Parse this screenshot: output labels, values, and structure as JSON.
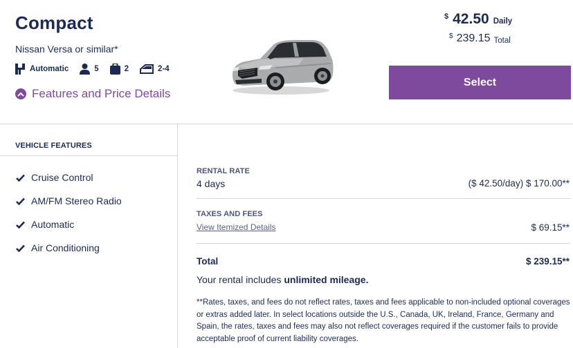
{
  "vehicle": {
    "class": "Compact",
    "model": "Nissan Versa or similar*",
    "transmission": "Automatic",
    "passengers": "5",
    "bags": "2",
    "doors": "2-4"
  },
  "features_toggle_label": "Features and Price Details",
  "pricing": {
    "currency_symbol": "$",
    "daily_amount": "42.50",
    "daily_label": "Daily",
    "total_amount": "239.15",
    "total_label": "Total"
  },
  "select_label": "Select",
  "vehicle_features": {
    "title": "VEHICLE FEATURES",
    "items": [
      "Cruise Control",
      "AM/FM Stereo Radio",
      "Automatic",
      "Air Conditioning"
    ]
  },
  "price_details": {
    "rental_rate": {
      "label": "RENTAL RATE",
      "duration": "4 days",
      "amount": "($ 42.50/day) $ 170.00**"
    },
    "taxes_fees": {
      "label": "TAXES AND FEES",
      "link": "View Itemized Details",
      "amount": "$ 69.15**"
    },
    "total": {
      "label": "Total",
      "amount": "$ 239.15**"
    },
    "mileage_prefix": "Your rental includes ",
    "mileage_bold": "unlimited mileage.",
    "disclaimer": "**Rates, taxes, and fees do not reflect rates, taxes and fees applicable to non-included optional coverages or extras added later. In select locations outside the U.S., Canada, UK, Ireland, France, Germany and Spain, the rates, taxes and fees may also not reflect coverages required if the customer fails to provide acceptable proof of current liability coverages."
  },
  "colors": {
    "accent": "#7e4a9e",
    "text": "#1b2a55",
    "divider": "#d5d5d9"
  }
}
